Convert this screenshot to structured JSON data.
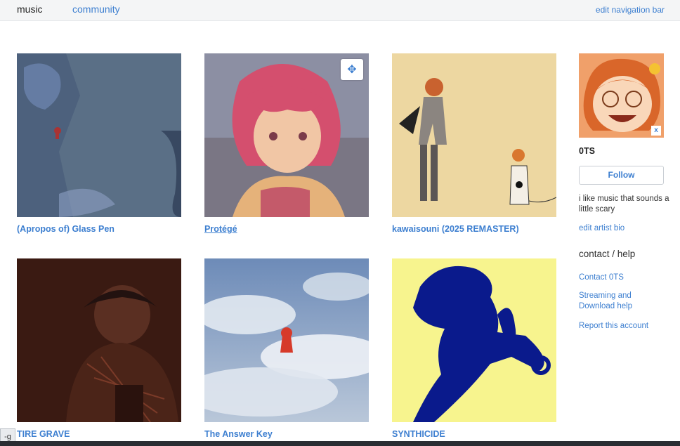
{
  "nav": {
    "music": "music",
    "community": "community",
    "edit": "edit navigation bar"
  },
  "albums": [
    {
      "title": "(Apropos of) Glass Pen"
    },
    {
      "title": "Protégé"
    },
    {
      "title": "kawaisouni (2025 REMASTER)"
    },
    {
      "title": "TIRE GRAVE"
    },
    {
      "title": "The Answer Key"
    },
    {
      "title": "SYNTHICIDE"
    }
  ],
  "move_icon": "✥",
  "sidebar": {
    "avatar_close": "x",
    "artist_name": "0TS",
    "follow_label": "Follow",
    "bio": "i like music that sounds a little scary",
    "edit_bio": "edit artist bio",
    "contact_heading": "contact / help",
    "links": [
      "Contact 0TS",
      "Streaming and Download help",
      "Report this account"
    ]
  },
  "bottom_tab": "-g",
  "colors": {
    "link": "#3d7fd0",
    "nav_bg": "#f4f5f6",
    "synthicide_bg": "#f7f48e",
    "synthicide_fg": "#0a1a8c"
  }
}
